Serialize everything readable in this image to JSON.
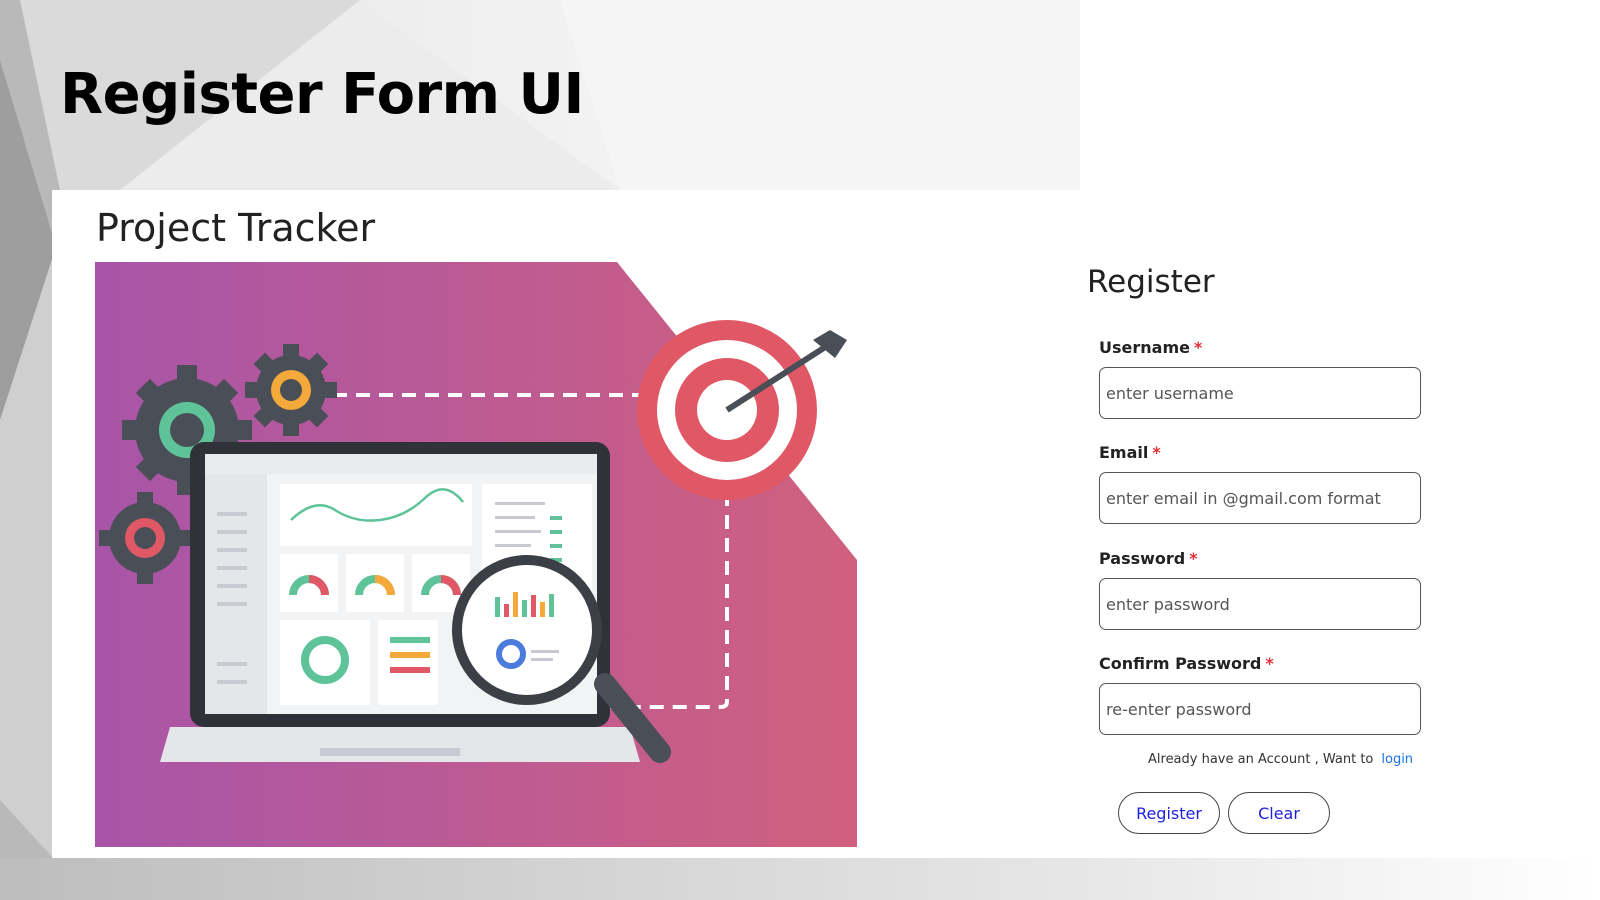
{
  "slide": {
    "title": "Register Form UI"
  },
  "app": {
    "title": "Project Tracker"
  },
  "register": {
    "heading": "Register",
    "fields": [
      {
        "label": "Username",
        "required_mark": "*",
        "placeholder": "enter username",
        "value": ""
      },
      {
        "label": "Email",
        "required_mark": "*",
        "placeholder": "enter email in @gmail.com format",
        "value": ""
      },
      {
        "label": "Password",
        "required_mark": "*",
        "placeholder": "enter password",
        "value": ""
      },
      {
        "label": "Confirm Password",
        "required_mark": "*",
        "placeholder": "re-enter password",
        "value": ""
      }
    ],
    "login_prompt": "Already have an Account , Want to",
    "login_link": "login",
    "buttons": {
      "register": "Register",
      "clear": "Clear"
    }
  },
  "colors": {
    "accent_link": "#1a73e8",
    "button_text": "#1f1fe0",
    "required": "#e0303a",
    "hero_gradient_start": "#a855a8",
    "hero_gradient_end": "#d0607e"
  },
  "icons": [
    "gear-icon",
    "target-icon",
    "arrow-icon",
    "laptop-icon",
    "magnifier-icon",
    "line-chart-icon",
    "gauge-icon",
    "donut-chart-icon",
    "bar-chart-icon"
  ]
}
